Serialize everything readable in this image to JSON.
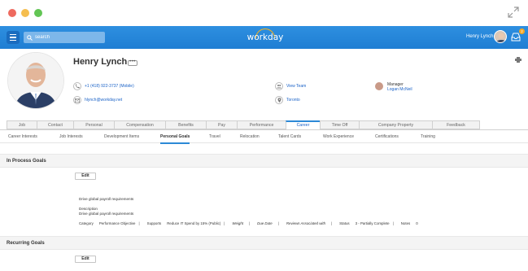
{
  "topbar": {
    "search_placeholder": "search",
    "logo_text": "workday",
    "user_name": "Henry Lynch",
    "notification_count": "2"
  },
  "profile": {
    "name": "Henry Lynch",
    "related_actions": "•••",
    "phone": "+1 (418) 922-3737 (Mobile)",
    "email": "hlynch@workday.net",
    "team_link": "View Team",
    "location": "Toronto",
    "manager_label": "Manager",
    "manager_name": "Logan McNeil"
  },
  "tabs": [
    {
      "label": "Job"
    },
    {
      "label": "Contact"
    },
    {
      "label": "Personal"
    },
    {
      "label": "Compensation"
    },
    {
      "label": "Benefits"
    },
    {
      "label": "Pay"
    },
    {
      "label": "Performance"
    },
    {
      "label": "Career",
      "active": true
    },
    {
      "label": "Time Off"
    },
    {
      "label": "Company Property"
    },
    {
      "label": "Feedback"
    }
  ],
  "subtabs": [
    {
      "label": "Career Interests"
    },
    {
      "label": "Job Interests"
    },
    {
      "label": "Development Items"
    },
    {
      "label": "Personal Goals",
      "active": true
    },
    {
      "label": "Travel"
    },
    {
      "label": "Relocation"
    },
    {
      "label": "Talent Cards"
    },
    {
      "label": "Work Experience"
    },
    {
      "label": "Certifications"
    },
    {
      "label": "Training"
    }
  ],
  "in_process": {
    "title": "In Process Goals",
    "edit_label": "Edit",
    "goal_name": "Drive global payroll requirements",
    "description_label": "Description",
    "description_value": "Drive global payroll requirements",
    "details": {
      "category_label": "Category",
      "category_value": "Performance Objective",
      "supports_label": "Supports",
      "supports_value": "Reduce IT Spend by 15% (Public)",
      "weight_label": "Weight",
      "due_date_label": "Due Date",
      "reviews_label": "Reviews Associated with",
      "status_label": "Status",
      "status_value": "3 - Partially Complete",
      "notes_label": "Notes",
      "notes_value": "0"
    }
  },
  "recurring": {
    "title": "Recurring Goals",
    "edit_label": "Edit"
  },
  "colors": {
    "topbar": "#2e8fe0",
    "link": "#1a62c7",
    "active_tab_accent": "#2c89d6",
    "logo_arc": "#f7b21c"
  }
}
